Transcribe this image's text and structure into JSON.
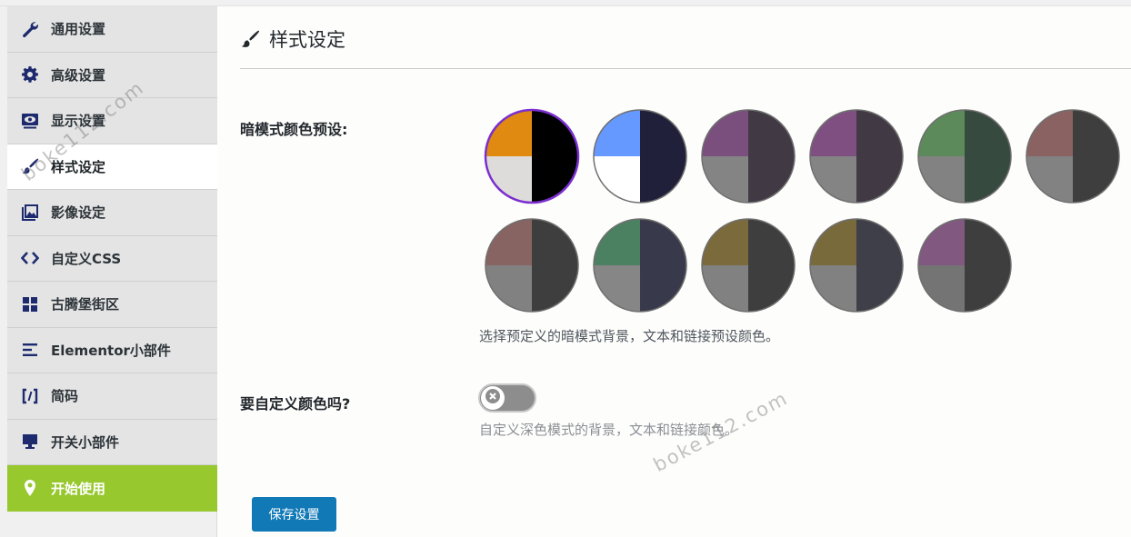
{
  "sidebar": {
    "items": [
      {
        "label": "通用设置",
        "icon": "wrench-icon"
      },
      {
        "label": "高级设置",
        "icon": "gear-icon"
      },
      {
        "label": "显示设置",
        "icon": "eye-monitor-icon"
      },
      {
        "label": "样式设定",
        "icon": "paintbrush-icon"
      },
      {
        "label": "影像设定",
        "icon": "image-gallery-icon"
      },
      {
        "label": "自定义CSS",
        "icon": "code-icon"
      },
      {
        "label": "古腾堡街区",
        "icon": "blocks-grid-icon"
      },
      {
        "label": "Elementor小部件",
        "icon": "elementor-icon"
      },
      {
        "label": "简码",
        "icon": "shortcode-icon"
      },
      {
        "label": "开关小部件",
        "icon": "desktop-icon"
      },
      {
        "label": "开始使用",
        "icon": "location-pin-icon"
      }
    ],
    "active_index": 3,
    "highlight_index": 10,
    "highlight_color": "#97c82e"
  },
  "header": {
    "title": "样式设定",
    "icon": "paintbrush-icon"
  },
  "presets": {
    "label": "暗模式颜色预设:",
    "description": "选择预定义的暗模式背景，文本和链接预设颜色。",
    "selected_index": 0,
    "selected_ring_color": "#7b2fd0",
    "swatches": [
      {
        "tl": "#e08a12",
        "right": "#000000",
        "bl": "#dddcda"
      },
      {
        "tl": "#6699ff",
        "right": "#20203a",
        "bl": "#ffffff"
      },
      {
        "tl": "#7a4f7e",
        "right": "#413944",
        "bl": "#848484"
      },
      {
        "tl": "#7f4f82",
        "right": "#413944",
        "bl": "#848484"
      },
      {
        "tl": "#5c8a5a",
        "right": "#374a3f",
        "bl": "#828282"
      },
      {
        "tl": "#8a6262",
        "right": "#3e3e3e",
        "bl": "#828282"
      },
      {
        "tl": "#876461",
        "right": "#3e3e3e",
        "bl": "#818181"
      },
      {
        "tl": "#4b8160",
        "right": "#383a4b",
        "bl": "#868686"
      },
      {
        "tl": "#7a6a3c",
        "right": "#3e3e3e",
        "bl": "#818181"
      },
      {
        "tl": "#796a3c",
        "right": "#3f3f49",
        "bl": "#818181"
      },
      {
        "tl": "#805880",
        "right": "#3e3e3e",
        "bl": "#747474"
      }
    ]
  },
  "custom_colors": {
    "label": "要自定义颜色吗?",
    "description": "自定义深色模式的背景，文本和链接颜色。",
    "enabled": false
  },
  "actions": {
    "save_label": "保存设置",
    "save_color": "#1279b7"
  },
  "watermark": {
    "text1": "boke112.com",
    "text2": "boke112.com"
  }
}
